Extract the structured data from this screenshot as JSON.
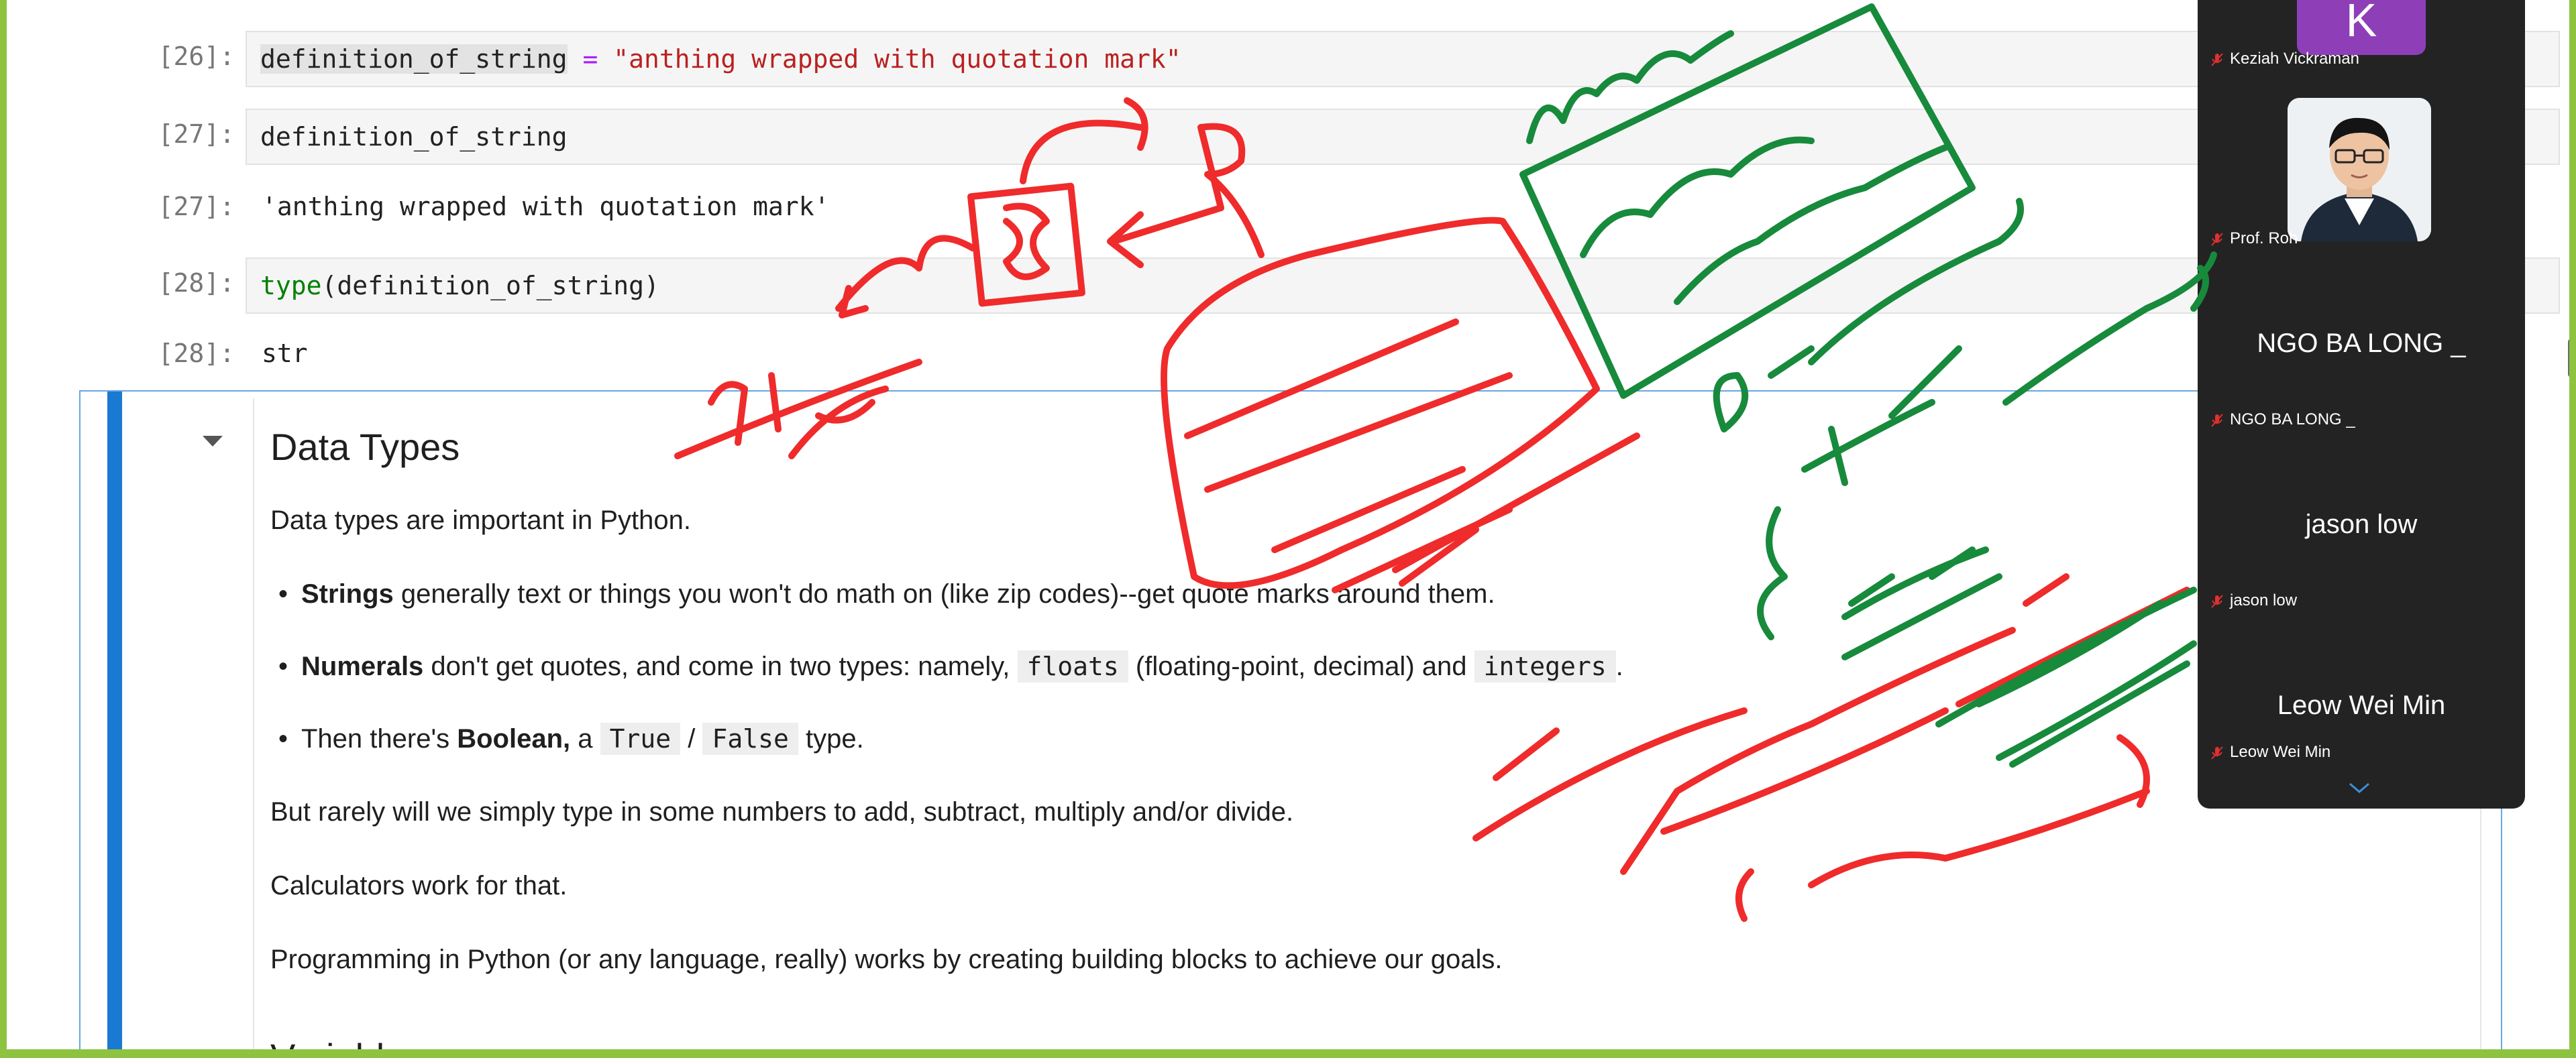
{
  "cells": [
    {
      "prompt": "[26]:",
      "input_var": "definition_of_string",
      "input_op": " = ",
      "input_str": "\"anthing wrapped with quotation mark\""
    },
    {
      "prompt": "[27]:",
      "input": "definition_of_string",
      "out_prompt": "[27]:",
      "output": "'anthing wrapped with quotation mark'"
    },
    {
      "prompt": "[28]:",
      "input_func": "type",
      "input_rest": "(definition_of_string)",
      "out_prompt": "[28]:",
      "output": "str"
    }
  ],
  "markdown": {
    "heading": "Data Types",
    "intro": "Data types are important in Python.",
    "bullets": {
      "strings_bold": "Strings",
      "strings_rest": " generally text or things you won't do math on (like zip codes)--get quote marks around them.",
      "numerals_bold": "Numerals",
      "numerals_rest": " don't get quotes, and come in two types: namely, ",
      "floats": "floats",
      "numerals_mid": " (floating-point, decimal) and ",
      "integers": "integers",
      "numerals_end": ".",
      "bool_pre": "Then there's ",
      "bool_bold": "Boolean,",
      "bool_mid": " a ",
      "true_code": "True",
      "slash": " / ",
      "false_code": "False",
      "bool_end": " type."
    },
    "p1": "But rarely will we simply type in some numbers to add, subtract, multiply and/or divide.",
    "p2": "Calculators work for that.",
    "p3": "Programming in Python (or any language, really) works by creating building blocks to achieve our goals.",
    "next_heading": "Variables"
  },
  "participants": [
    {
      "name": "Keziah Vickraman",
      "avatar_letter": "K",
      "avatar_color": "#8e3fb8"
    },
    {
      "name": "Prof. Roh"
    },
    {
      "display": "NGO BA LONG _",
      "name": "NGO BA LONG _"
    },
    {
      "display": "jason low",
      "name": "jason low"
    },
    {
      "display": "Leow Wei Min",
      "name": "Leow Wei Min"
    }
  ],
  "ink_colors": {
    "red": "#ef2b2b",
    "green": "#178a3c"
  }
}
